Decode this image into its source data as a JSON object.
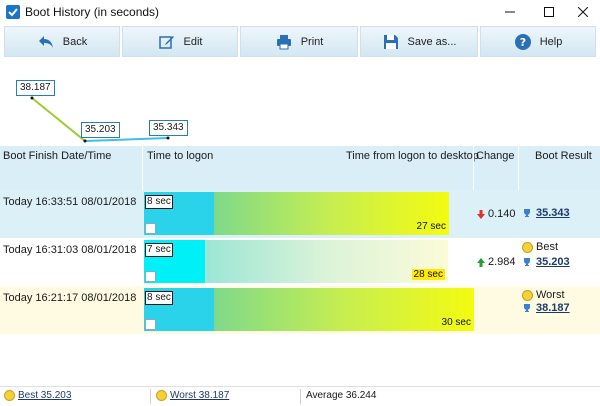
{
  "window": {
    "title": "Boot History (in seconds)",
    "min_icon": "minimize-icon",
    "max_icon": "maximize-icon",
    "close_icon": "close-icon"
  },
  "toolbar": {
    "back": "Back",
    "edit": "Edit",
    "print": "Print",
    "save": "Save as...",
    "help": "Help"
  },
  "graph": {
    "points": [
      "38.187",
      "35.203",
      "35.343"
    ]
  },
  "table": {
    "col_date": "Boot Finish Date/Time",
    "col_logon": "Time to logon",
    "col_desktop": "Time from logon to desktop",
    "col_change": "Change",
    "col_result": "Boot Result",
    "rows": [
      {
        "date": "Today  16:33:51 08/01/2018",
        "logon": "8 sec",
        "logon_seconds": 8,
        "desktop": "27 sec",
        "desktop_seconds": 27,
        "change": "0.140",
        "change_dir": "down",
        "tag": "",
        "score": "35.343"
      },
      {
        "date": "Today  16:31:03 08/01/2018",
        "logon": "7 sec",
        "logon_seconds": 7,
        "desktop": "28 sec",
        "desktop_seconds": 28,
        "change": "2.984",
        "change_dir": "up",
        "tag": "Best",
        "score": "35.203"
      },
      {
        "date": "Today  16:21:17 08/01/2018",
        "logon": "8 sec",
        "logon_seconds": 8,
        "desktop": "30 sec",
        "desktop_seconds": 30,
        "change": "",
        "change_dir": "",
        "tag": "Worst",
        "score": "38.187"
      }
    ]
  },
  "status": {
    "best": "Best 35.203",
    "worst": "Worst 38.187",
    "average": "Average 36.244"
  }
}
